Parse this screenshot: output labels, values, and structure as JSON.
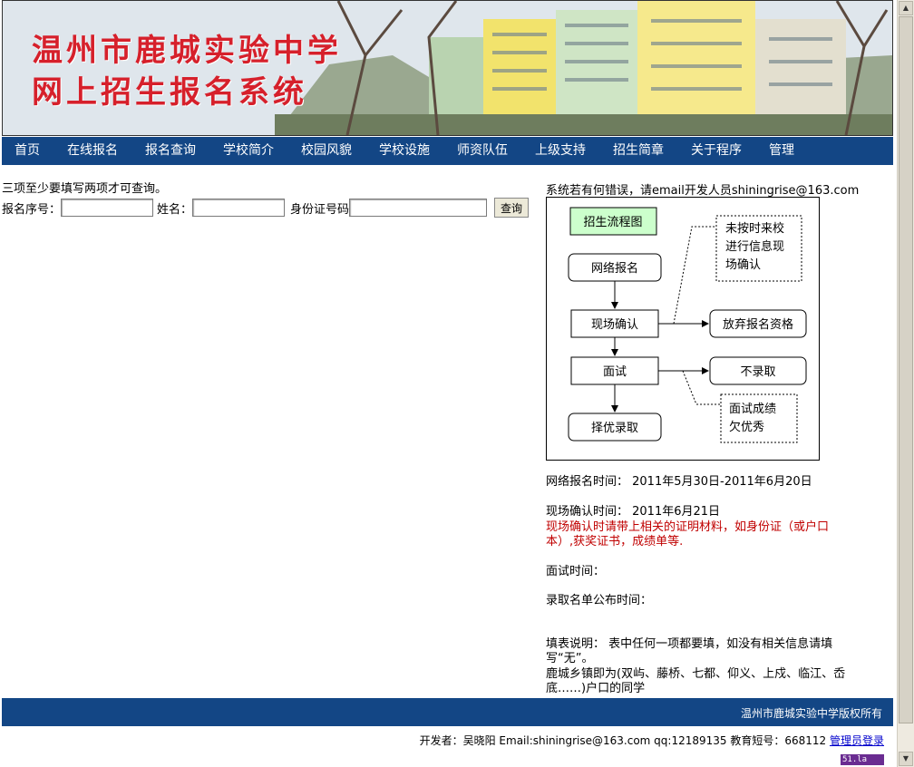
{
  "banner": {
    "title_line1": "温州市鹿城实验中学",
    "title_line2": "网上招生报名系统"
  },
  "nav": {
    "items": [
      "首页",
      "在线报名",
      "报名查询",
      "学校简介",
      "校园风貌",
      "学校设施",
      "师资队伍",
      "上级支持",
      "招生简章",
      "关于程序",
      "管理"
    ]
  },
  "search": {
    "note": "三项至少要填写两项才可查询。",
    "serial_label": "报名序号：",
    "name_label": "姓名：",
    "id_label": "身份证号码",
    "button_label": "查询",
    "serial_value": "",
    "name_value": "",
    "id_value": ""
  },
  "contact": "系统若有何错误，请email开发人员shiningrise@163.com",
  "flowchart": {
    "title": "招生流程图",
    "step1": "网络报名",
    "step2": "现场确认",
    "step3": "面试",
    "step4": "择优录取",
    "branch_giveup": "放弃报名资格",
    "branch_reject": "不录取",
    "note_top_l1": "未按时来校",
    "note_top_l2": "进行信息现",
    "note_top_l3": "场确认",
    "note_bottom_l1": "面试成绩",
    "note_bottom_l2": "欠优秀"
  },
  "info": {
    "online_time": "网络报名时间：  2011年5月30日-2011年6月20日",
    "confirm_time": "现场确认时间：  2011年6月21日",
    "confirm_note": "现场确认时请带上相关的证明材料，如身份证（或户口本）,获奖证书，成绩单等.",
    "interview_time": "面试时间：",
    "publish_time": "录取名单公布时间：",
    "fill_note": "填表说明：   表中任何一项都要填，如没有相关信息请填写“无”。",
    "town_note": "鹿城乡镇即为(双屿、藤桥、七都、仰义、上戍、临江、岙底……)户口的同学"
  },
  "footer": {
    "copyright": "温州市鹿城实验中学版权所有",
    "developer": "开发者：吴晓阳  Email:shiningrise@163.com qq:12189135 教育短号：668112 ",
    "admin_link": "管理员登录",
    "badge": "51.la"
  },
  "colors": {
    "nav_bg": "#134685",
    "title_red": "#d6202b",
    "note_red": "#c00000",
    "flow_title_bg": "#ccffcc"
  }
}
